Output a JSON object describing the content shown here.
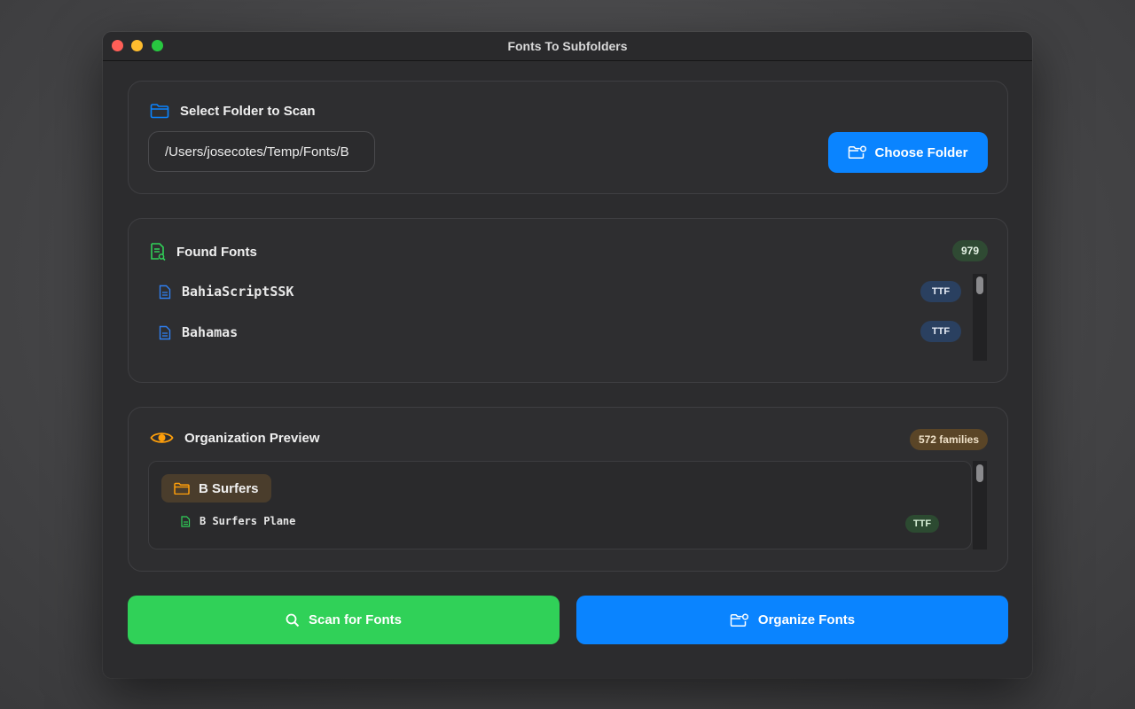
{
  "window": {
    "title": "Fonts To Subfolders"
  },
  "select_folder": {
    "heading": "Select Folder to Scan",
    "path_value": "/Users/josecotes/Temp/Fonts/B",
    "choose_label": "Choose Folder"
  },
  "found_fonts": {
    "heading": "Found Fonts",
    "count": "979",
    "items": [
      {
        "name": "BahiaScriptSSK",
        "type": "TTF"
      },
      {
        "name": "Bahamas",
        "type": "TTF"
      }
    ]
  },
  "preview": {
    "heading": "Organization Preview",
    "count": "572 families",
    "folders": [
      {
        "name": "B Surfers",
        "files": [
          {
            "name": "B Surfers Plane",
            "type": "TTF"
          }
        ]
      }
    ]
  },
  "actions": {
    "scan_label": "Scan for Fonts",
    "organize_label": "Organize Fonts"
  },
  "colors": {
    "accent_blue": "#0a84ff",
    "accent_green": "#30d158",
    "accent_orange": "#ff9f0a"
  }
}
